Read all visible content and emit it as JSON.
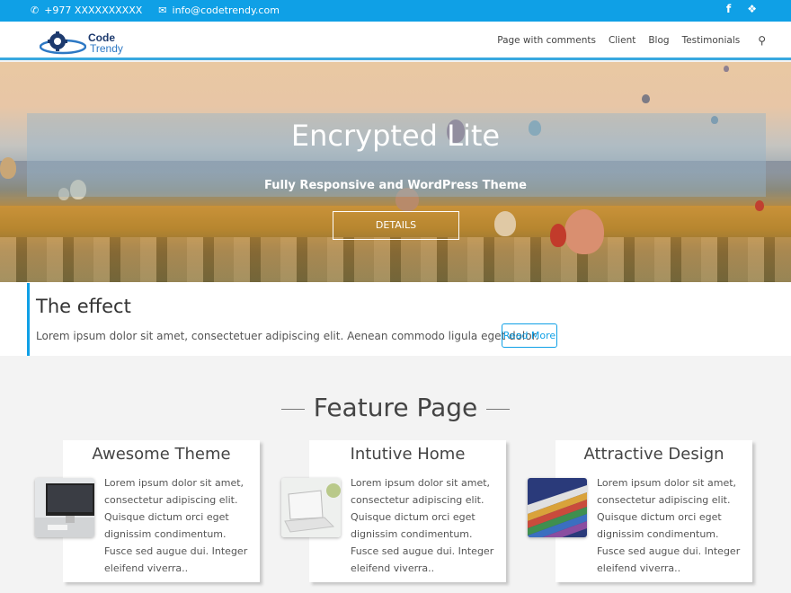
{
  "topbar": {
    "phone": "+977 XXXXXXXXXX",
    "email": "info@codetrendy.com",
    "icons": [
      "phone-icon",
      "envelope-icon",
      "facebook-icon",
      "twitter-icon"
    ],
    "color": "#0fa0e6"
  },
  "header": {
    "logo_line1": "Code",
    "logo_line2": "Trendy",
    "nav": [
      "Page with comments",
      "Client",
      "Blog",
      "Testimonials"
    ],
    "search_icon": "search-icon"
  },
  "hero": {
    "title": "Encrypted Lite",
    "subtitle": "Fully Responsive and WordPress Theme",
    "button": "DETAILS"
  },
  "effect": {
    "title": "The effect",
    "text": "Lorem ipsum dolor sit amet, consectetuer adipiscing elit. Aenean commodo ligula eget dolor.",
    "button": "Read More",
    "accent": "#0fa0e6"
  },
  "features": {
    "title": "Feature Page",
    "cards": [
      {
        "title": "Awesome Theme",
        "text": "Lorem ipsum dolor sit amet, consectetur adipiscing elit. Quisque dictum orci eget dignissim condimentum. Fusce sed augue dui. Integer eleifend viverra.."
      },
      {
        "title": "Intutive Home",
        "text": "Lorem ipsum dolor sit amet, consectetur adipiscing elit. Quisque dictum orci eget dignissim condimentum. Fusce sed augue dui. Integer eleifend viverra.."
      },
      {
        "title": "Attractive Design",
        "text": "Lorem ipsum dolor sit amet, consectetur adipiscing elit. Quisque dictum orci eget dignissim condimentum. Fusce sed augue dui. Integer eleifend viverra.."
      }
    ]
  }
}
